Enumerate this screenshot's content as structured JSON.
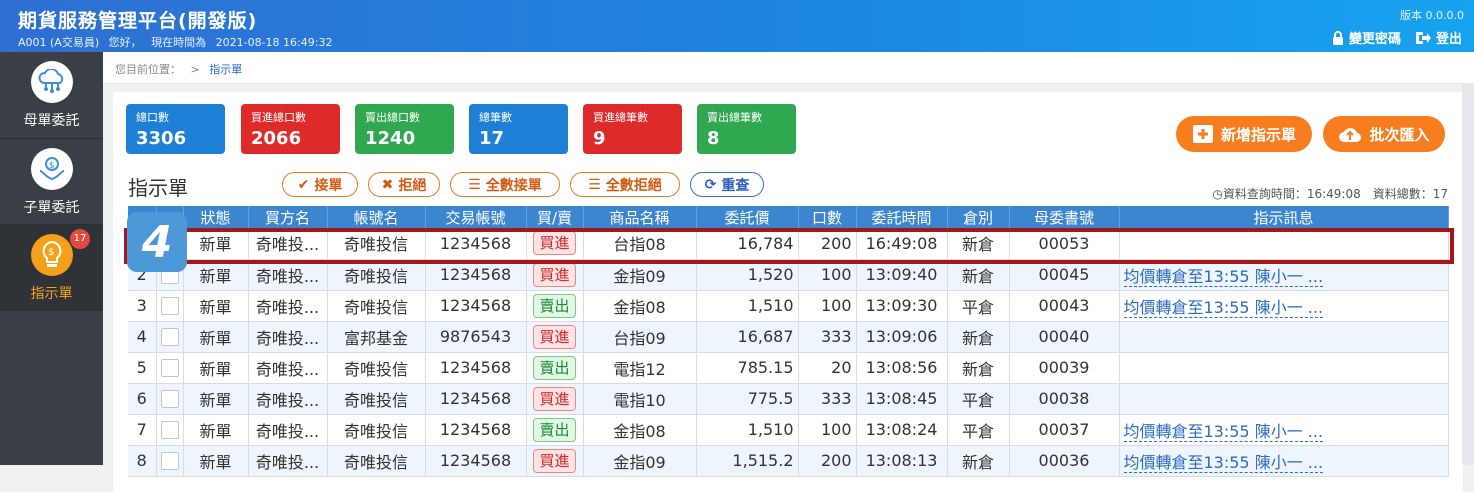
{
  "header": {
    "title": "期貨服務管理平台(開發版)",
    "user": "A001 (A交易員)",
    "greeting": "您好，",
    "time_label": "現在時間為",
    "time": "2021-08-18 16:49:32",
    "version": "版本 0.0.0.0",
    "change_password": "變更密碼",
    "logout": "登出"
  },
  "sidebar": {
    "items": [
      {
        "label": "母單委託",
        "icon": "cloud-network-icon"
      },
      {
        "label": "子單委託",
        "icon": "coin-hand-icon"
      },
      {
        "label": "指示單",
        "icon": "lightbulb-coin-icon",
        "badge": "17"
      }
    ]
  },
  "breadcrumb": {
    "prefix": "您目前位置：",
    "sep": ">",
    "current": "指示單"
  },
  "stats": [
    {
      "label": "總口數",
      "value": "3306"
    },
    {
      "label": "買進總口數",
      "value": "2066"
    },
    {
      "label": "賣出總口數",
      "value": "1240"
    },
    {
      "label": "總筆數",
      "value": "17"
    },
    {
      "label": "買進總筆數",
      "value": "9"
    },
    {
      "label": "賣出總筆數",
      "value": "8"
    }
  ],
  "actions": {
    "add": "新增指示單",
    "import": "批次匯入"
  },
  "section": {
    "title": "指示單",
    "accept": "接單",
    "reject": "拒絕",
    "accept_all": "全數接單",
    "reject_all": "全數拒絕",
    "reset": "重查",
    "query_time_label": "資料查詢時間：16:49:08",
    "total_label": "資料總數：17"
  },
  "columns": [
    "",
    "",
    "狀態",
    "買方名",
    "帳號名",
    "交易帳號",
    "買/賣",
    "商品名稱",
    "委託價",
    "口數",
    "委託時間",
    "倉別",
    "母委書號",
    "指示訊息"
  ],
  "rows": [
    {
      "no": "1",
      "status": "新單",
      "buyer": "奇唯投...",
      "account": "奇唯投信",
      "acct_no": "1234568",
      "side": "買進",
      "product": "台指08",
      "price": "16,784",
      "qty": "200",
      "time": "16:49:08",
      "pos": "新倉",
      "parent": "00053",
      "msg": ""
    },
    {
      "no": "2",
      "status": "新單",
      "buyer": "奇唯投...",
      "account": "奇唯投信",
      "acct_no": "1234568",
      "side": "買進",
      "product": "金指09",
      "price": "1,520",
      "qty": "100",
      "time": "13:09:40",
      "pos": "新倉",
      "parent": "00045",
      "msg": "均價轉倉至13:55  陳小一 ..."
    },
    {
      "no": "3",
      "status": "新單",
      "buyer": "奇唯投...",
      "account": "奇唯投信",
      "acct_no": "1234568",
      "side": "賣出",
      "product": "金指08",
      "price": "1,510",
      "qty": "100",
      "time": "13:09:30",
      "pos": "平倉",
      "parent": "00043",
      "msg": "均價轉倉至13:55  陳小一 ..."
    },
    {
      "no": "4",
      "status": "新單",
      "buyer": "奇唯投...",
      "account": "富邦基金",
      "acct_no": "9876543",
      "side": "買進",
      "product": "台指09",
      "price": "16,687",
      "qty": "333",
      "time": "13:09:06",
      "pos": "新倉",
      "parent": "00040",
      "msg": ""
    },
    {
      "no": "5",
      "status": "新單",
      "buyer": "奇唯投...",
      "account": "奇唯投信",
      "acct_no": "1234568",
      "side": "賣出",
      "product": "電指12",
      "price": "785.15",
      "qty": "20",
      "time": "13:08:56",
      "pos": "新倉",
      "parent": "00039",
      "msg": ""
    },
    {
      "no": "6",
      "status": "新單",
      "buyer": "奇唯投...",
      "account": "奇唯投信",
      "acct_no": "1234568",
      "side": "買進",
      "product": "電指10",
      "price": "775.5",
      "qty": "333",
      "time": "13:08:45",
      "pos": "平倉",
      "parent": "00038",
      "msg": ""
    },
    {
      "no": "7",
      "status": "新單",
      "buyer": "奇唯投...",
      "account": "奇唯投信",
      "acct_no": "1234568",
      "side": "賣出",
      "product": "金指08",
      "price": "1,510",
      "qty": "100",
      "time": "13:08:24",
      "pos": "平倉",
      "parent": "00037",
      "msg": "均價轉倉至13:55  陳小一 ..."
    },
    {
      "no": "8",
      "status": "新單",
      "buyer": "奇唯投...",
      "account": "奇唯投信",
      "acct_no": "1234568",
      "side": "買進",
      "product": "金指09",
      "price": "1,515.2",
      "qty": "200",
      "time": "13:08:13",
      "pos": "新倉",
      "parent": "00036",
      "msg": "均價轉倉至13:55  陳小一 ..."
    }
  ],
  "step_marker": "4",
  "colors": {
    "header_blue": "#1d86e0",
    "accent_orange": "#f77d1f",
    "highlight_red": "#a3161a",
    "buy_red": "#d62a2a",
    "sell_green": "#1e8a3a"
  }
}
